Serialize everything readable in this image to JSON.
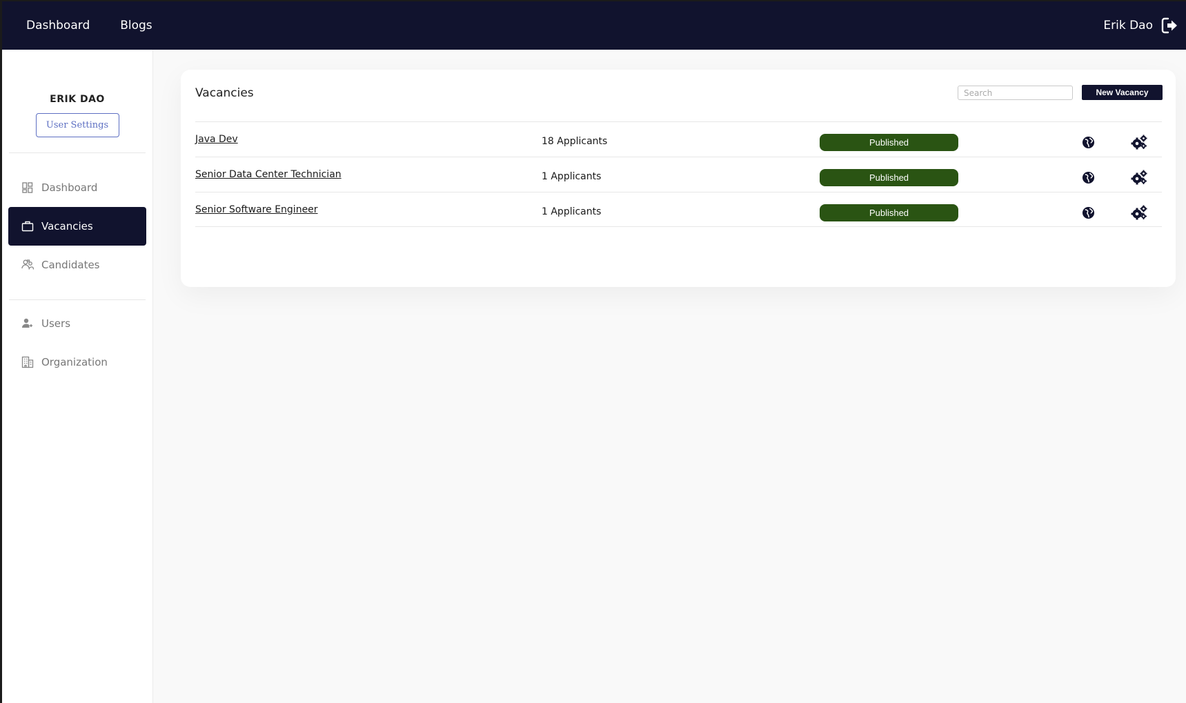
{
  "topbar": {
    "nav": [
      "Dashboard",
      "Blogs"
    ],
    "user_name": "Erik Dao",
    "logout_icon": "logout-icon",
    "bg_color": "#11132e"
  },
  "sidebar": {
    "profile_name": "ERIK DAO",
    "settings_label": "User Settings",
    "items": [
      {
        "label": "Dashboard",
        "icon": "dashboard-icon",
        "active": false
      },
      {
        "label": "Vacancies",
        "icon": "briefcase-icon",
        "active": true
      },
      {
        "label": "Candidates",
        "icon": "candidates-icon",
        "active": false
      }
    ],
    "items2": [
      {
        "label": "Users",
        "icon": "user-icon",
        "active": false
      },
      {
        "label": "Organization",
        "icon": "building-icon",
        "active": false
      }
    ]
  },
  "main": {
    "title": "Vacancies",
    "search_placeholder": "Search",
    "new_button": "New Vacancy",
    "rows": [
      {
        "name": "Java Dev",
        "applicants": "18 Applicants",
        "status": "Published"
      },
      {
        "name": "Senior Data Center Technician",
        "applicants": "1 Applicants",
        "status": "Published"
      },
      {
        "name": "Senior Software Engineer",
        "applicants": "1 Applicants",
        "status": "Published"
      }
    ],
    "status_color": "#2a5413",
    "row_icons": [
      "globe-icon",
      "gears-icon"
    ]
  }
}
